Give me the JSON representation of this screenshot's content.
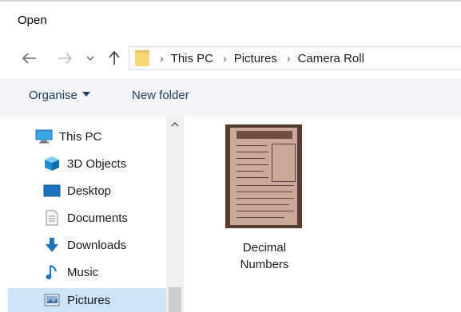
{
  "window": {
    "title": "Open"
  },
  "navigation": {
    "back_icon": "arrow-left-icon",
    "forward_icon": "arrow-right-icon",
    "recent_icon": "chevron-down-icon",
    "up_icon": "arrow-up-icon"
  },
  "address_bar": {
    "folder_icon": "folder-icon",
    "breadcrumbs": [
      "This PC",
      "Pictures",
      "Camera Roll"
    ],
    "separator": "›"
  },
  "toolbar": {
    "organise_label": "Organise",
    "new_folder_label": "New folder"
  },
  "sidebar": {
    "items": [
      {
        "label": "This PC",
        "icon": "monitor-icon"
      },
      {
        "label": "3D Objects",
        "icon": "cube-icon"
      },
      {
        "label": "Desktop",
        "icon": "desktop-icon"
      },
      {
        "label": "Documents",
        "icon": "document-icon"
      },
      {
        "label": "Downloads",
        "icon": "download-icon"
      },
      {
        "label": "Music",
        "icon": "music-icon"
      },
      {
        "label": "Pictures",
        "icon": "pictures-icon"
      }
    ],
    "selected": "Pictures"
  },
  "files": [
    {
      "name_line1": "Decimal",
      "name_line2": "Numbers",
      "type": "image"
    }
  ],
  "colors": {
    "selection": "#cce4f7",
    "toolbar_bg": "#f3f5f8",
    "accent_blue": "#1e73be",
    "folder_yellow": "#f8d775"
  }
}
